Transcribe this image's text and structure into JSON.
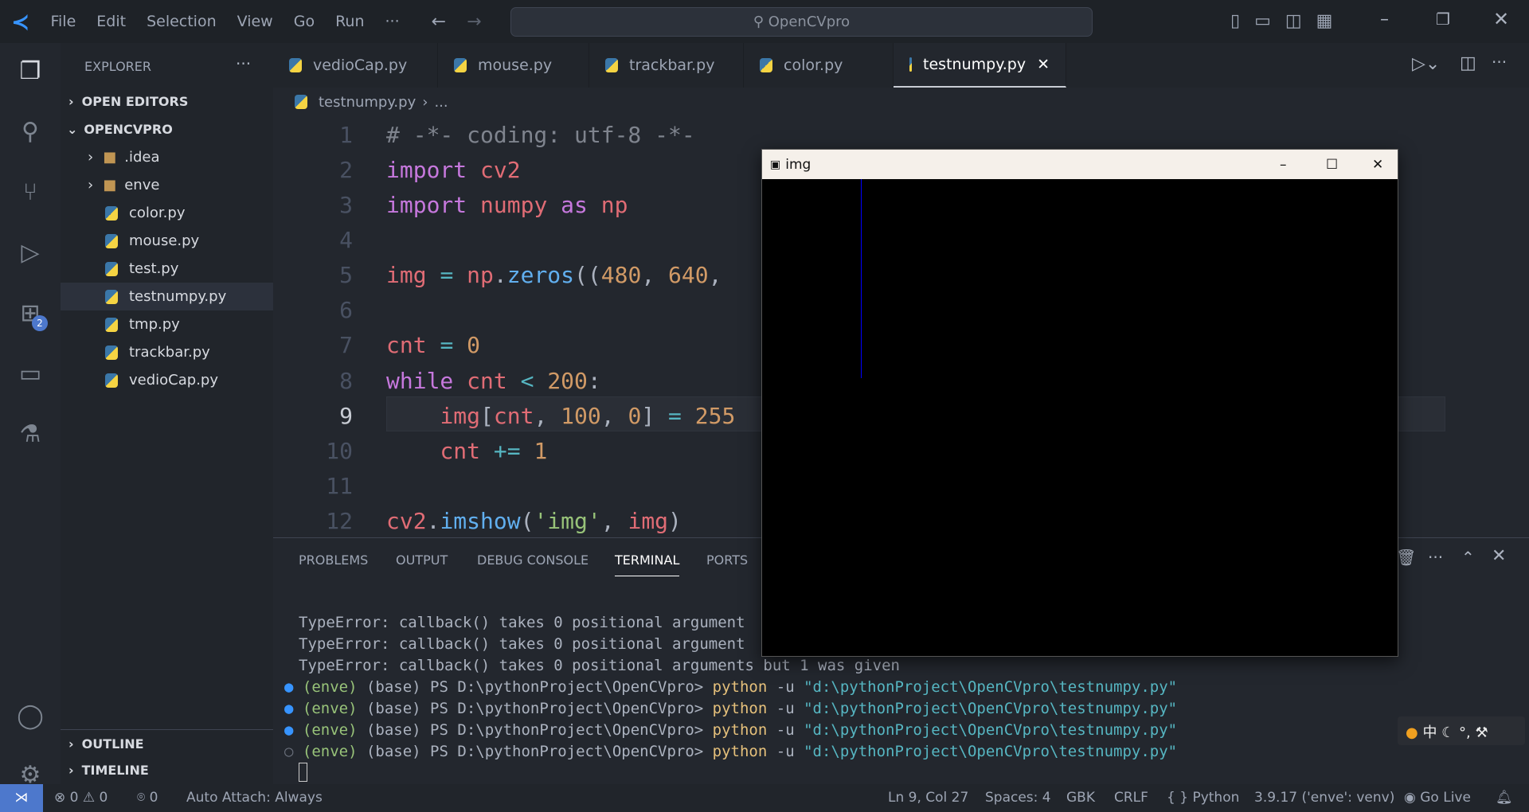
{
  "titlebar": {
    "menu": [
      "File",
      "Edit",
      "Selection",
      "View",
      "Go",
      "Run",
      "···"
    ],
    "search": "OpenCVpro"
  },
  "sidebar": {
    "title": "EXPLORER",
    "open_editors": "OPEN EDITORS",
    "project": "OPENCVPRO",
    "items": [
      {
        "label": ".idea",
        "type": "folder"
      },
      {
        "label": "enve",
        "type": "folder"
      },
      {
        "label": "color.py"
      },
      {
        "label": "mouse.py"
      },
      {
        "label": "test.py"
      },
      {
        "label": "testnumpy.py",
        "selected": true
      },
      {
        "label": "tmp.py"
      },
      {
        "label": "trackbar.py"
      },
      {
        "label": "vedioCap.py"
      }
    ],
    "outline": "OUTLINE",
    "timeline": "TIMELINE",
    "extensions_badge": "2"
  },
  "tabs": [
    {
      "label": "vedioCap.py"
    },
    {
      "label": "mouse.py"
    },
    {
      "label": "trackbar.py"
    },
    {
      "label": "color.py"
    },
    {
      "label": "testnumpy.py",
      "active": true
    }
  ],
  "breadcrumb": {
    "file": "testnumpy.py",
    "more": "..."
  },
  "code": {
    "line_numbers": [
      "1",
      "2",
      "3",
      "4",
      "5",
      "6",
      "7",
      "8",
      "9",
      "10",
      "11",
      "12"
    ],
    "current_line": "9",
    "lines": [
      "# -*- coding: utf-8 -*-",
      "import cv2",
      "import numpy as np",
      "",
      "img = np.zeros((480, 640,",
      "",
      "cnt = 0",
      "while cnt < 200:",
      "    img[cnt, 100, 0] = 255",
      "    cnt += 1",
      "",
      "cv2.imshow('img', img)"
    ]
  },
  "panel": {
    "tabs": [
      "PROBLEMS",
      "OUTPUT",
      "DEBUG CONSOLE",
      "TERMINAL",
      "PORTS"
    ],
    "active": "TERMINAL",
    "terminal": [
      "TypeError: callback() takes 0 positional argument",
      "TypeError: callback() takes 0 positional argument",
      "TypeError: callback() takes 0 positional arguments but 1 was given"
    ],
    "prompt": {
      "env": "(enve)",
      "rest": " (base) PS D:\\pythonProject\\OpenCVpro> ",
      "cmd": "python",
      "flag": " -u ",
      "path": "\"d:\\pythonProject\\OpenCVpro\\testnumpy.py\""
    }
  },
  "img_window": {
    "title": "img"
  },
  "statusbar": {
    "errors": "0",
    "warnings": "0",
    "ports": "0",
    "auto_attach": "Auto Attach: Always",
    "position": "Ln 9, Col 27",
    "spaces": "Spaces: 4",
    "encoding": "GBK",
    "eol": "CRLF",
    "language": "Python",
    "interpreter": "3.9.17 ('enve': venv)",
    "golive": "Go Live"
  },
  "colors": {
    "accent": "#61afef",
    "status_remote": "#4d78cc"
  }
}
